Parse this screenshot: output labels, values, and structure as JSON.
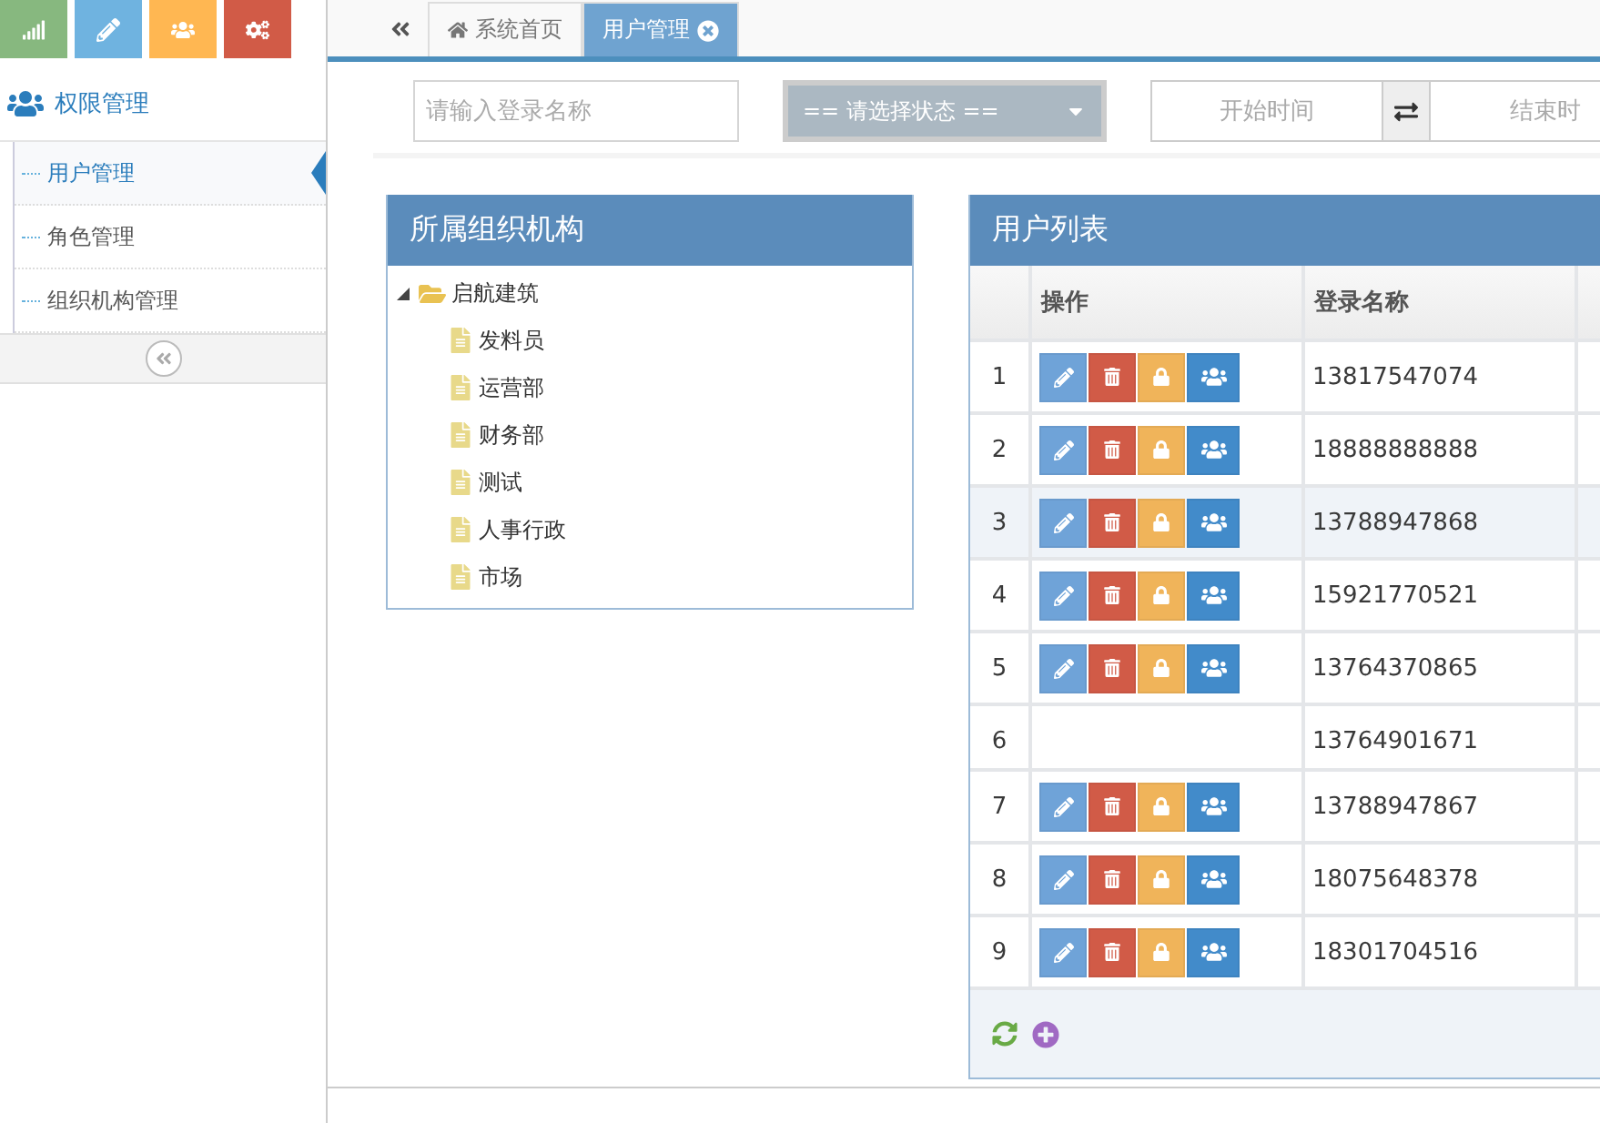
{
  "toolbar": {
    "buttons": [
      {
        "kind": "chart",
        "color": "#87b87f"
      },
      {
        "kind": "edit",
        "color": "#6fb3e0"
      },
      {
        "kind": "users",
        "color": "#ffb752"
      },
      {
        "kind": "cogs",
        "color": "#d15b47"
      }
    ]
  },
  "sidebar": {
    "title": "权限管理",
    "items": [
      {
        "label": "用户管理",
        "selected": true
      },
      {
        "label": "角色管理",
        "selected": false
      },
      {
        "label": "组织机构管理",
        "selected": false
      }
    ]
  },
  "tabs": [
    {
      "label": "系统首页",
      "selected": false,
      "closable": false
    },
    {
      "label": "用户管理",
      "selected": true,
      "closable": true
    }
  ],
  "filters": {
    "login_placeholder": "请输入登录名称",
    "status": "== 请选择状态 ==",
    "start_placeholder": "开始时间",
    "end_placeholder": "结束时"
  },
  "org_panel": {
    "title": "所属组织机构",
    "tree": [
      {
        "label": "启航建筑",
        "expanded": true,
        "children": [
          {
            "label": "发料员"
          },
          {
            "label": "运营部"
          },
          {
            "label": "财务部"
          },
          {
            "label": "测试"
          },
          {
            "label": "人事行政"
          },
          {
            "label": "市场"
          }
        ]
      }
    ]
  },
  "user_panel": {
    "title": "用户列表",
    "columns": [
      "操作",
      "登录名称"
    ],
    "rows": [
      {
        "index": "1",
        "login": "13817547074",
        "actions": true,
        "selected": false
      },
      {
        "index": "2",
        "login": "18888888888",
        "actions": true,
        "selected": false
      },
      {
        "index": "3",
        "login": "13788947868",
        "actions": true,
        "selected": true
      },
      {
        "index": "4",
        "login": "15921770521",
        "actions": true,
        "selected": false
      },
      {
        "index": "5",
        "login": "13764370865",
        "actions": true,
        "selected": false
      },
      {
        "index": "6",
        "login": "13764901671",
        "actions": false,
        "selected": false
      },
      {
        "index": "7",
        "login": "13788947867",
        "actions": true,
        "selected": false
      },
      {
        "index": "8",
        "login": "18075648378",
        "actions": true,
        "selected": false
      },
      {
        "index": "9",
        "login": "18301704516",
        "actions": true,
        "selected": false
      }
    ]
  }
}
